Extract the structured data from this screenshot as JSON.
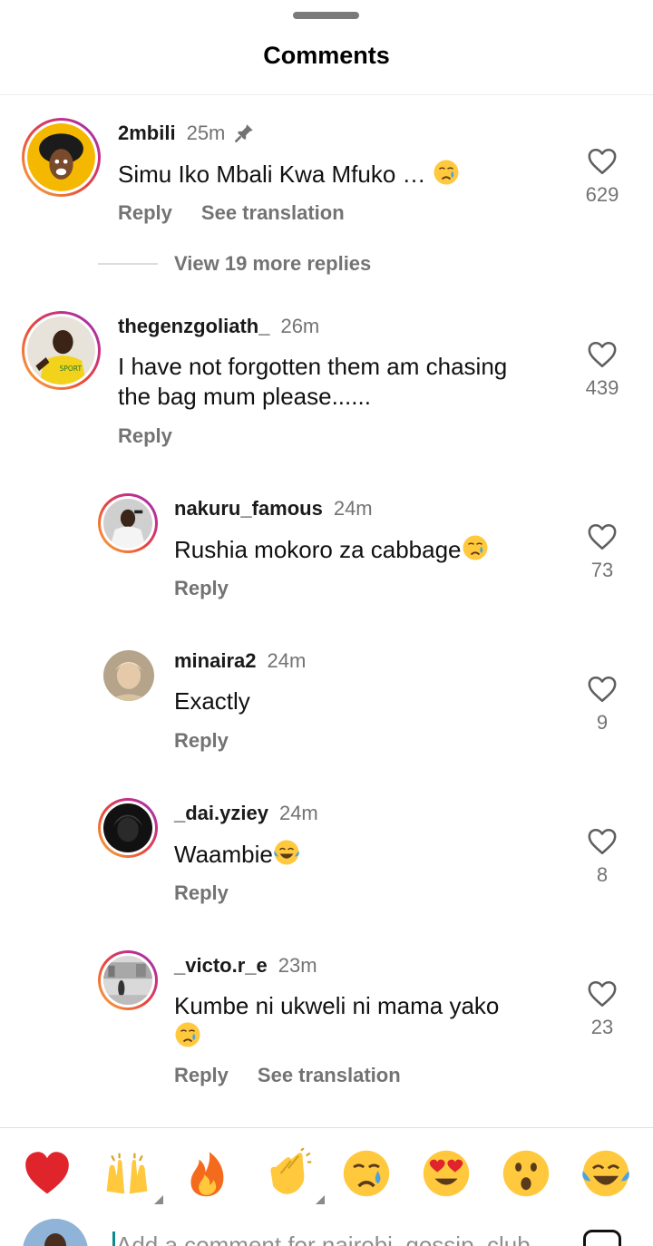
{
  "sheet": {
    "title": "Comments"
  },
  "comments": [
    {
      "user": "2mbili",
      "time": "25m",
      "pinned": true,
      "text": "Simu Iko Mbali Kwa Mfuko …",
      "emoji": "crying-face",
      "reply": "Reply",
      "translate": "See translation",
      "likes": "629"
    },
    {
      "user": "thegenzgoliath_",
      "time": "26m",
      "pinned": false,
      "text_line1": "I have not forgotten them am chasing",
      "text_line2": "the bag mum please......",
      "reply": "Reply",
      "likes": "439"
    }
  ],
  "view_replies": "View 19 more replies",
  "replies": [
    {
      "user": "nakuru_famous",
      "time": "24m",
      "text": "Rushia mokoro za cabbage",
      "emoji": "crying-face",
      "reply": "Reply",
      "likes": "73"
    },
    {
      "user": "minaira2",
      "time": "24m",
      "text": "Exactly",
      "reply": "Reply",
      "likes": "9"
    },
    {
      "user": "_dai.yziey",
      "time": "24m",
      "text": "Waambie",
      "emoji": "tears-of-joy",
      "reply": "Reply",
      "likes": "8"
    },
    {
      "user": "_victo.r_e",
      "time": "23m",
      "text": "Kumbe ni ukweli ni mama yako",
      "emoji": "crying-face",
      "reply": "Reply",
      "translate": "See translation",
      "likes": "23"
    }
  ],
  "emoji_bar": [
    "red-heart",
    "raising-hands",
    "fire",
    "clapping-hands",
    "crying-face",
    "heart-eyes",
    "surprised-face",
    "tears-of-joy"
  ],
  "composer": {
    "placeholder": "Add a comment for nairobi_gossip_club"
  },
  "colors": {
    "muted": "#737373",
    "ring_start": "#f9b13a",
    "ring_end": "#8a3ab9",
    "heart": "#e0242c"
  }
}
